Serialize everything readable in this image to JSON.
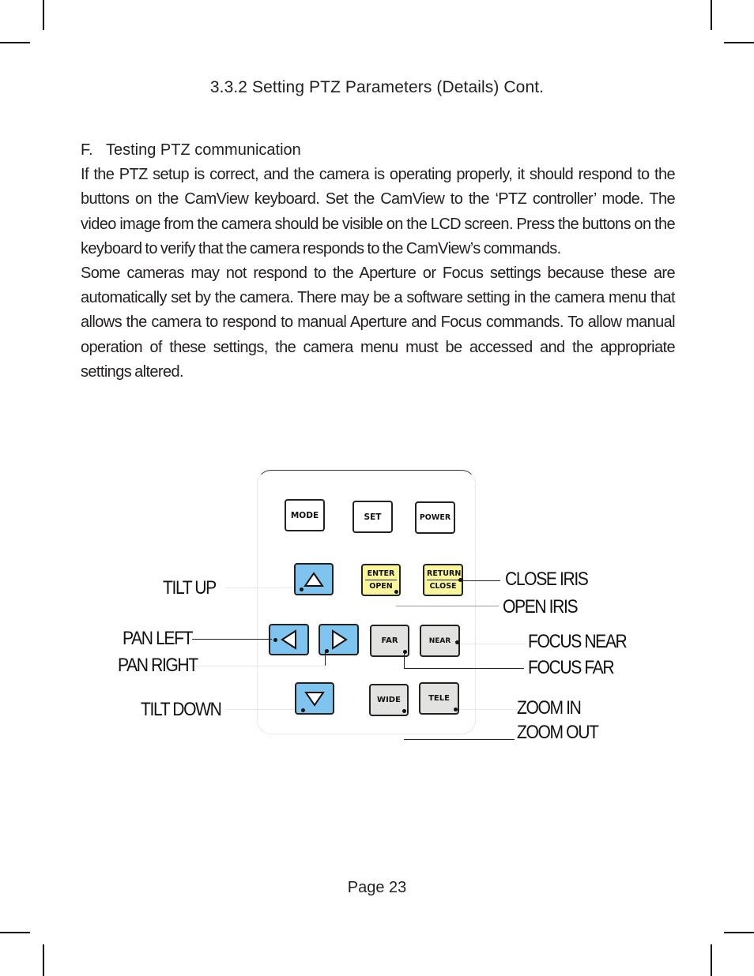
{
  "section": {
    "title": "3.3.2  Setting PTZ Parameters (Details) Cont."
  },
  "body": {
    "subheading_letter": "F.",
    "subheading_text": "Testing PTZ communication",
    "paragraph1": "If the PTZ setup is correct, and the camera is operating properly, it should respond to the buttons on the CamView keyboard. Set the CamView to the ‘PTZ controller’ mode. The video image from the camera should be visible on the LCD screen. Press the buttons on the keyboard to verify that the camera responds to the CamView’s commands.",
    "paragraph2": "Some cameras may not respond to the Aperture or Focus settings because these are automatically set by the camera. There may be a software setting in the camera menu that allows the camera to respond to manual Aperture and Focus commands. To allow manual operation of these settings, the camera menu must be accessed and the appropriate settings altered."
  },
  "keyboard": {
    "row1": [
      "MODE",
      "SET",
      "POWER"
    ],
    "tilt_up_icon": "triangle-up",
    "enter_open": {
      "top": "ENTER",
      "bottom": "OPEN"
    },
    "return_close": {
      "top": "RETURN",
      "bottom": "CLOSE"
    },
    "pan_left_icon": "triangle-left",
    "pan_right_icon": "triangle-right",
    "far": "FAR",
    "near": "NEAR",
    "tilt_down_icon": "triangle-down",
    "wide": "WIDE",
    "tele": "TELE",
    "colors": {
      "direction_keys": "#7fc4ee",
      "iris_keys": "#fbf59c",
      "lens_keys": "#e2e2e0"
    }
  },
  "callouts": {
    "tilt_up": "TILT UP",
    "pan_left": "PAN LEFT",
    "pan_right": "PAN RIGHT",
    "tilt_down": "TILT DOWN",
    "close_iris": "CLOSE IRIS",
    "open_iris": "OPEN IRIS",
    "focus_near": "FOCUS NEAR",
    "focus_far": "FOCUS FAR",
    "zoom_in": "ZOOM IN",
    "zoom_out": "ZOOM OUT"
  },
  "footer": {
    "page_label": "Page 23"
  }
}
